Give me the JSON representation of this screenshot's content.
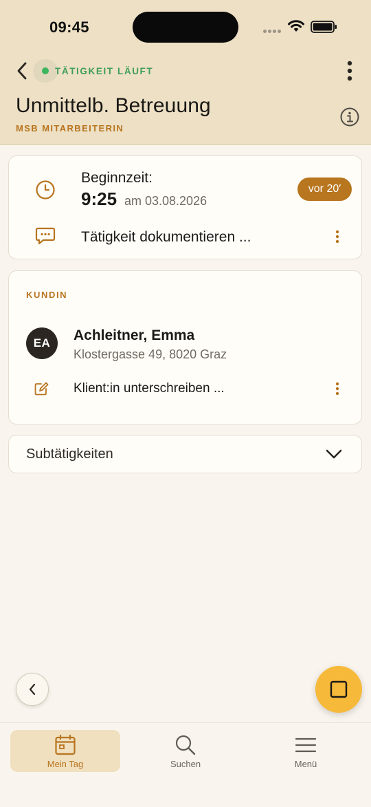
{
  "status_bar": {
    "time": "09:45"
  },
  "header": {
    "status_label": "TÄTIGKEIT LÄUFT",
    "title": "Unmittelb. Betreuung",
    "subtitle": "MSB MITARBEITERIN"
  },
  "time_card": {
    "begin_label": "Beginnzeit:",
    "begin_time": "9:25",
    "begin_date": "am 03.08.2026",
    "elapsed_badge": "vor 20′",
    "document_action": "Tätigkeit dokumentieren ..."
  },
  "client_card": {
    "section_label": "KUNDIN",
    "avatar_initials": "EA",
    "client_name": "Achleitner, Emma",
    "client_address": "Klostergasse 49, 8020 Graz",
    "sign_action": "Klient:in unterschreiben ..."
  },
  "subtasks": {
    "label": "Subtätigkeiten"
  },
  "tabbar": {
    "items": [
      {
        "label": "Mein Tag",
        "icon": "calendar-icon",
        "active": true
      },
      {
        "label": "Suchen",
        "icon": "search-icon",
        "active": false
      },
      {
        "label": "Menü",
        "icon": "menu-icon",
        "active": false
      }
    ]
  },
  "colors": {
    "accent": "#b8741e",
    "header_bg": "#ede0c5",
    "status_green": "#3cb55f",
    "fab": "#f6b93a"
  }
}
